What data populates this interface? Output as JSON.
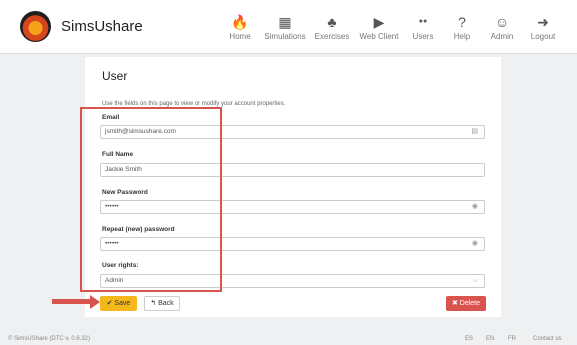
{
  "brand": "SimsUshare",
  "nav": [
    {
      "label": "Home",
      "icon": "fire-icon",
      "glyph": "🔥"
    },
    {
      "label": "Simulations",
      "icon": "map-icon",
      "glyph": "▦"
    },
    {
      "label": "Exercises",
      "icon": "sitemap-icon",
      "glyph": "♣"
    },
    {
      "label": "Web Client",
      "icon": "play-icon",
      "glyph": "▶"
    },
    {
      "label": "Users",
      "icon": "users-icon",
      "glyph": "●●"
    },
    {
      "label": "Help",
      "icon": "help-icon",
      "glyph": "?"
    },
    {
      "label": "Admin",
      "icon": "user-icon",
      "glyph": "☺"
    },
    {
      "label": "Logout",
      "icon": "logout-icon",
      "glyph": "➜"
    }
  ],
  "page": {
    "title": "User",
    "intro": "Use the fields on this page to view or modify your account properties.",
    "email_label": "Email",
    "email_value": "jsmith@simsushare.com",
    "name_label": "Full Name",
    "name_value": "Jackie Smith",
    "new_pw_label": "New Password",
    "new_pw_value": "••••••",
    "repeat_pw_label": "Repeat (new) password",
    "repeat_pw_value": "••••••",
    "rights_label": "User rights:",
    "rights_value": "Admin"
  },
  "buttons": {
    "save": "✔ Save",
    "back": "↰ Back",
    "delete": "✖ Delete"
  },
  "footer": {
    "copyright": "© SimsUShare (DTC v. 0.6.32)",
    "langs": [
      "ES",
      "EN",
      "FR"
    ],
    "contact": "Contact us"
  },
  "colors": {
    "accent": "#f5b81c",
    "danger": "#d9534f",
    "highlight": "#d9534f"
  }
}
